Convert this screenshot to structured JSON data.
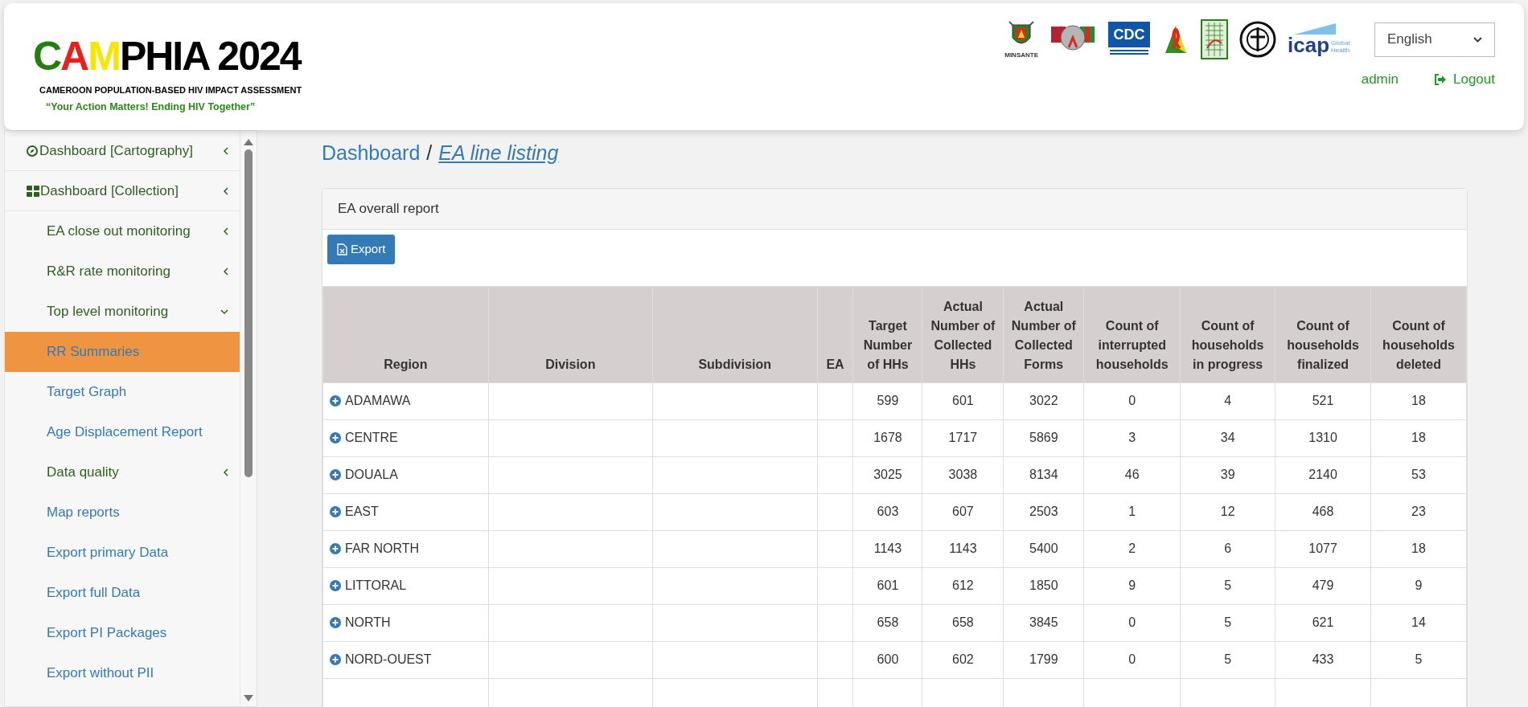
{
  "header": {
    "logo": {
      "title_parts": [
        {
          "text": "C",
          "color": "#23800f"
        },
        {
          "text": "A",
          "color": "#e8211b"
        },
        {
          "text": "M",
          "color": "#f7e600"
        },
        {
          "text": "PHIA 2024",
          "color": "#000000"
        }
      ],
      "subtitle": "CAMEROON POPULATION-BASED HIV IMPACT ASSESSMENT",
      "tagline": "“Your Action Matters! Ending HIV Together”"
    },
    "partner_logos": [
      {
        "kind": "emblem",
        "label": "MINSANTE"
      },
      {
        "kind": "flags"
      },
      {
        "kind": "cdc",
        "label": "CDC"
      },
      {
        "kind": "ribbon"
      },
      {
        "kind": "map"
      },
      {
        "kind": "seal"
      },
      {
        "kind": "icap",
        "label": "icap",
        "sublabel": "Global Health"
      }
    ],
    "language": {
      "value": "English"
    },
    "user": "admin",
    "logout": "Logout"
  },
  "sidebar": {
    "items": [
      {
        "kind": "menu",
        "label": "Dashboard [Cartography]",
        "expanded": false,
        "selected": false
      },
      {
        "kind": "menu",
        "label": "Dashboard [Collection]",
        "expanded": false,
        "selected": false,
        "children": [
          {
            "kind": "menu",
            "label": "EA close out monitoring",
            "expanded": false,
            "selected": false
          },
          {
            "kind": "menu",
            "label": "R&R rate monitoring",
            "expanded": false,
            "selected": false
          },
          {
            "kind": "menu",
            "label": "Top level monitoring",
            "expanded": true,
            "selected": false
          },
          {
            "kind": "link",
            "label": "RR Summaries",
            "selected": true
          },
          {
            "kind": "link",
            "label": "Target Graph",
            "selected": false
          },
          {
            "kind": "link",
            "label": "Age Displacement Report",
            "selected": false
          },
          {
            "kind": "menu",
            "label": "Data quality",
            "expanded": false,
            "selected": false
          },
          {
            "kind": "link",
            "label": "Map reports",
            "selected": false
          },
          {
            "kind": "link",
            "label": "Export primary Data",
            "selected": false
          },
          {
            "kind": "link",
            "label": "Export full Data",
            "selected": false
          },
          {
            "kind": "link",
            "label": "Export PI Packages",
            "selected": false
          },
          {
            "kind": "link",
            "label": "Export without PII",
            "selected": false
          }
        ]
      }
    ]
  },
  "breadcrumb": {
    "root": "Dashboard",
    "separator": "/",
    "current": "EA line listing"
  },
  "panel": {
    "title": "EA overall report",
    "export_button": "Export",
    "table": {
      "columns": [
        "Region",
        "Division",
        "Subdivision",
        "EA",
        "Target Number of HHs",
        "Actual Number of Collected HHs",
        "Actual Number of Collected Forms",
        "Count of interrupted households",
        "Count of households in progress",
        "Count of households finalized",
        "Count of households deleted"
      ],
      "rows": [
        [
          "ADAMAWA",
          "",
          "",
          "",
          "599",
          "601",
          "3022",
          "0",
          "4",
          "521",
          "18"
        ],
        [
          "CENTRE",
          "",
          "",
          "",
          "1678",
          "1717",
          "5869",
          "3",
          "34",
          "1310",
          "18"
        ],
        [
          "DOUALA",
          "",
          "",
          "",
          "3025",
          "3038",
          "8134",
          "46",
          "39",
          "2140",
          "53"
        ],
        [
          "EAST",
          "",
          "",
          "",
          "603",
          "607",
          "2503",
          "1",
          "12",
          "468",
          "23"
        ],
        [
          "FAR NORTH",
          "",
          "",
          "",
          "1143",
          "1143",
          "5400",
          "2",
          "6",
          "1077",
          "18"
        ],
        [
          "LITTORAL",
          "",
          "",
          "",
          "601",
          "612",
          "1850",
          "9",
          "5",
          "479",
          "9"
        ],
        [
          "NORTH",
          "",
          "",
          "",
          "658",
          "658",
          "3845",
          "0",
          "5",
          "621",
          "14"
        ],
        [
          "NORD-OUEST",
          "",
          "",
          "",
          "600",
          "602",
          "1799",
          "0",
          "5",
          "433",
          "5"
        ]
      ]
    }
  }
}
